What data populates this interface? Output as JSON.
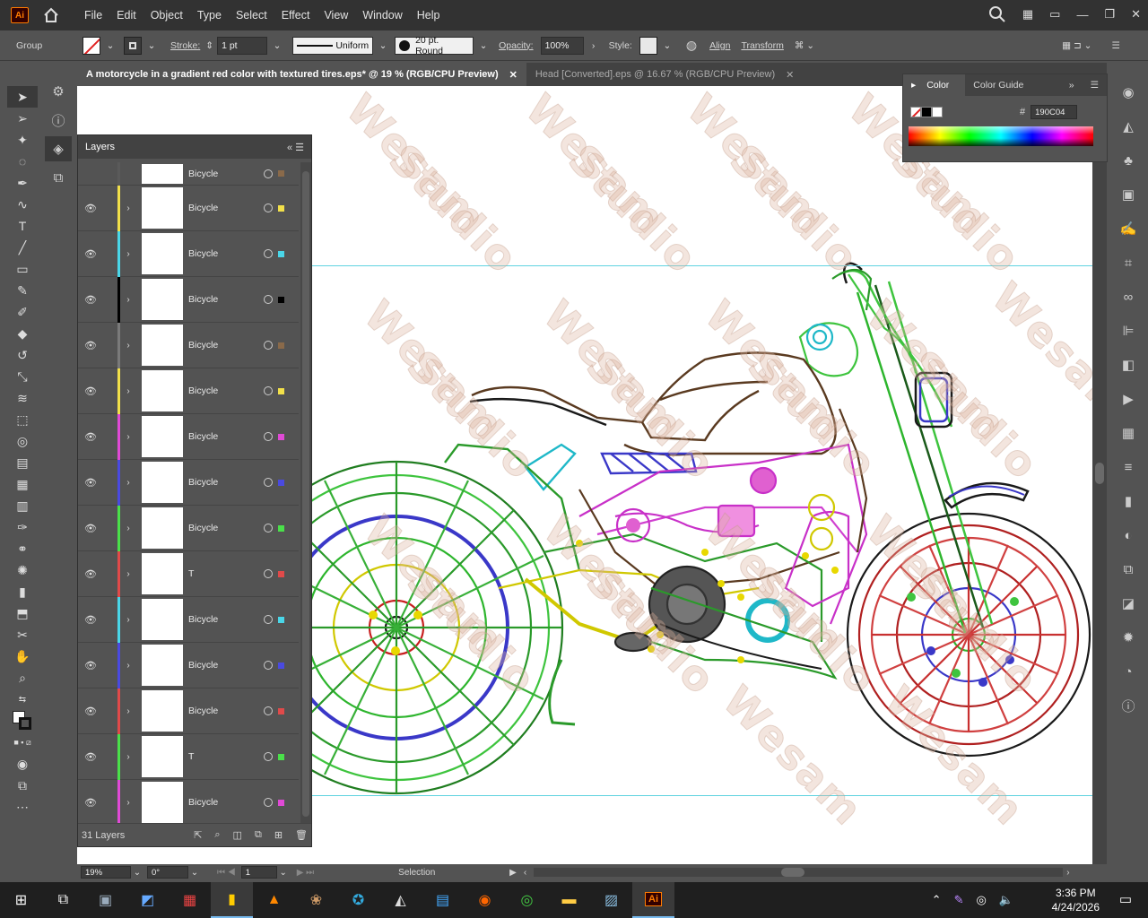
{
  "app": {
    "logo": "Ai"
  },
  "menu": [
    "File",
    "Edit",
    "Object",
    "Type",
    "Select",
    "Effect",
    "View",
    "Window",
    "Help"
  ],
  "control": {
    "group_label": "Group",
    "stroke_label": "Stroke:",
    "stroke_value": "1 pt",
    "profile": "Uniform",
    "brush": "20 pt. Round",
    "opacity_label": "Opacity:",
    "opacity_value": "100%",
    "style_label": "Style:",
    "align": "Align",
    "transform": "Transform"
  },
  "tabs": [
    {
      "label": "A motorcycle in a gradient red color with textured tires.eps* @ 19 % (RGB/CPU Preview)",
      "active": true
    },
    {
      "label": "Head [Converted].eps @ 16.67 % (RGB/CPU Preview)",
      "active": false
    }
  ],
  "color_panel": {
    "tab_color": "Color",
    "tab_guide": "Color Guide",
    "hex_symbol": "#",
    "hex_value": "190C04"
  },
  "layers_panel": {
    "title": "Layers",
    "count": "31 Layers",
    "layers": [
      {
        "name": "Bicycle",
        "color": "#5a5a5a",
        "sel": "#8a6a4a"
      },
      {
        "name": "Bicycle",
        "color": "#f2e04a",
        "sel": "#f2e04a"
      },
      {
        "name": "Bicycle",
        "color": "#4ad6e8",
        "sel": "#4ad6e8"
      },
      {
        "name": "Bicycle",
        "color": "#000000",
        "sel": "#000000"
      },
      {
        "name": "Bicycle",
        "color": "#7a7a7a",
        "sel": "#8a6a4a"
      },
      {
        "name": "Bicycle",
        "color": "#f2e04a",
        "sel": "#f2e04a"
      },
      {
        "name": "Bicycle",
        "color": "#e04ad6",
        "sel": "#e04ad6"
      },
      {
        "name": "Bicycle",
        "color": "#4a4ae0",
        "sel": "#4a4ae0"
      },
      {
        "name": "Bicycle",
        "color": "#4ae04a",
        "sel": "#4ae04a"
      },
      {
        "name": "T",
        "color": "#e04a4a",
        "sel": "#e04a4a"
      },
      {
        "name": "Bicycle",
        "color": "#4ad6e8",
        "sel": "#4ad6e8"
      },
      {
        "name": "Bicycle",
        "color": "#4a4ae0",
        "sel": "#4a4ae0"
      },
      {
        "name": "Bicycle",
        "color": "#e04a4a",
        "sel": "#e04a4a"
      },
      {
        "name": "T",
        "color": "#4ae04a",
        "sel": "#4ae04a"
      },
      {
        "name": "Bicycle",
        "color": "#e04ad6",
        "sel": "#e04ad6"
      }
    ]
  },
  "status": {
    "zoom": "19%",
    "rotation": "0°",
    "artboard": "1",
    "tool": "Selection"
  },
  "watermark": {
    "line1": "Wesam",
    "line2": "Studio"
  },
  "taskbar": {
    "time": "3:36 PM",
    "date": "4/24/2026"
  }
}
